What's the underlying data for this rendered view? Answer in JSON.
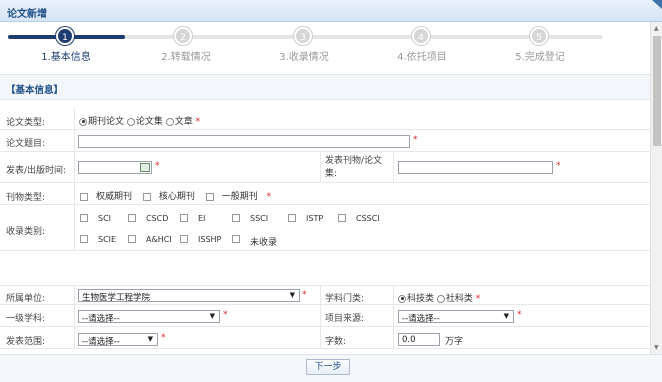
{
  "window": {
    "title": "论文新增"
  },
  "steps": [
    {
      "num": "1",
      "label": "1.基本信息",
      "active": true
    },
    {
      "num": "2",
      "label": "2.转载情况",
      "active": false
    },
    {
      "num": "3",
      "label": "3.收录情况",
      "active": false
    },
    {
      "num": "4",
      "label": "4.依托项目",
      "active": false
    },
    {
      "num": "5",
      "label": "5.完成登记",
      "active": false
    }
  ],
  "section": {
    "title": "【基本信息】"
  },
  "form": {
    "paper_type": {
      "label": "论文类型:",
      "options": [
        "期刊论文",
        "论文集",
        "文章"
      ],
      "selected": "期刊论文"
    },
    "paper_title": {
      "label": "论文题目:",
      "value": ""
    },
    "publish_time": {
      "label": "发表/出版时间:",
      "value": ""
    },
    "journal": {
      "label": "发表刊物/论文集:",
      "value": ""
    },
    "journal_type": {
      "label": "刊物类型:",
      "options": [
        "权威期刊",
        "核心期刊",
        "一般期刊"
      ]
    },
    "index_category": {
      "label": "收录类别:",
      "options_row1": [
        "SCI",
        "CSCD",
        "EI",
        "SSCI",
        "ISTP",
        "CSSCI"
      ],
      "options_row2": [
        "SCIE",
        "A&HCI",
        "ISSHP",
        "未收录"
      ]
    },
    "unit": {
      "label": "所属单位:",
      "value": "生物医学工程学院"
    },
    "discipline": {
      "label": "学科门类:",
      "options": [
        "科技类",
        "社科类"
      ],
      "selected": "科技类"
    },
    "first_subject": {
      "label": "一级学科:",
      "value": "--请选择--"
    },
    "project_source": {
      "label": "项目来源:",
      "value": "--请选择--"
    },
    "publish_scope": {
      "label": "发表范围:",
      "value": "--请选择--"
    },
    "word_count": {
      "label": "字数:",
      "value": "0.0",
      "unit": "万字"
    }
  },
  "required_mark": "*",
  "footer": {
    "next_label": "下一步"
  },
  "colors": {
    "accent": "#1d3d70",
    "title": "#1e4e86",
    "required": "#e02020"
  }
}
